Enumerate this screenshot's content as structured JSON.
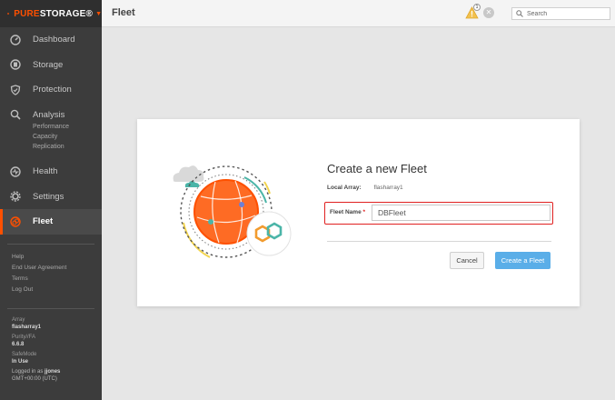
{
  "brand": {
    "name_part1": "PURE",
    "name_part2": "STORAGE",
    "reg": "®"
  },
  "nav": [
    {
      "label": "Dashboard",
      "icon": "dashboard-icon"
    },
    {
      "label": "Storage",
      "icon": "storage-icon"
    },
    {
      "label": "Protection",
      "icon": "shield-icon"
    },
    {
      "label": "Analysis",
      "icon": "analysis-icon",
      "subitems": [
        "Performance",
        "Capacity",
        "Replication"
      ]
    },
    {
      "label": "Health",
      "icon": "health-icon"
    },
    {
      "label": "Settings",
      "icon": "gear-icon"
    },
    {
      "label": "Fleet",
      "icon": "fleet-icon",
      "active": true
    }
  ],
  "links": [
    "Help",
    "End User Agreement",
    "Terms",
    "Log Out"
  ],
  "info": {
    "array_label": "Array",
    "array_value": "flasharray1",
    "purity_label": "Purity//FA",
    "purity_value": "6.6.8",
    "safemode_label": "SafeMode",
    "safemode_value": "In Use",
    "logged_prefix": "Logged in as",
    "user": "jjones",
    "timezone": "GMT+00:00 (UTC)"
  },
  "header": {
    "title": "Fleet",
    "alert_count": "1",
    "search_placeholder": "Search"
  },
  "modal": {
    "title": "Create a new Fleet",
    "local_array_label": "Local Array:",
    "local_array_value": "flasharray1",
    "fleet_name_label": "Fleet Name",
    "required_mark": "*",
    "fleet_name_value": "DBFleet",
    "cancel_label": "Cancel",
    "create_label": "Create a Fleet"
  },
  "colors": {
    "brand_orange": "#fe5000",
    "sidebar_bg": "#3c3c3c",
    "primary_button": "#5aaee8",
    "highlight_red": "#e02020"
  }
}
